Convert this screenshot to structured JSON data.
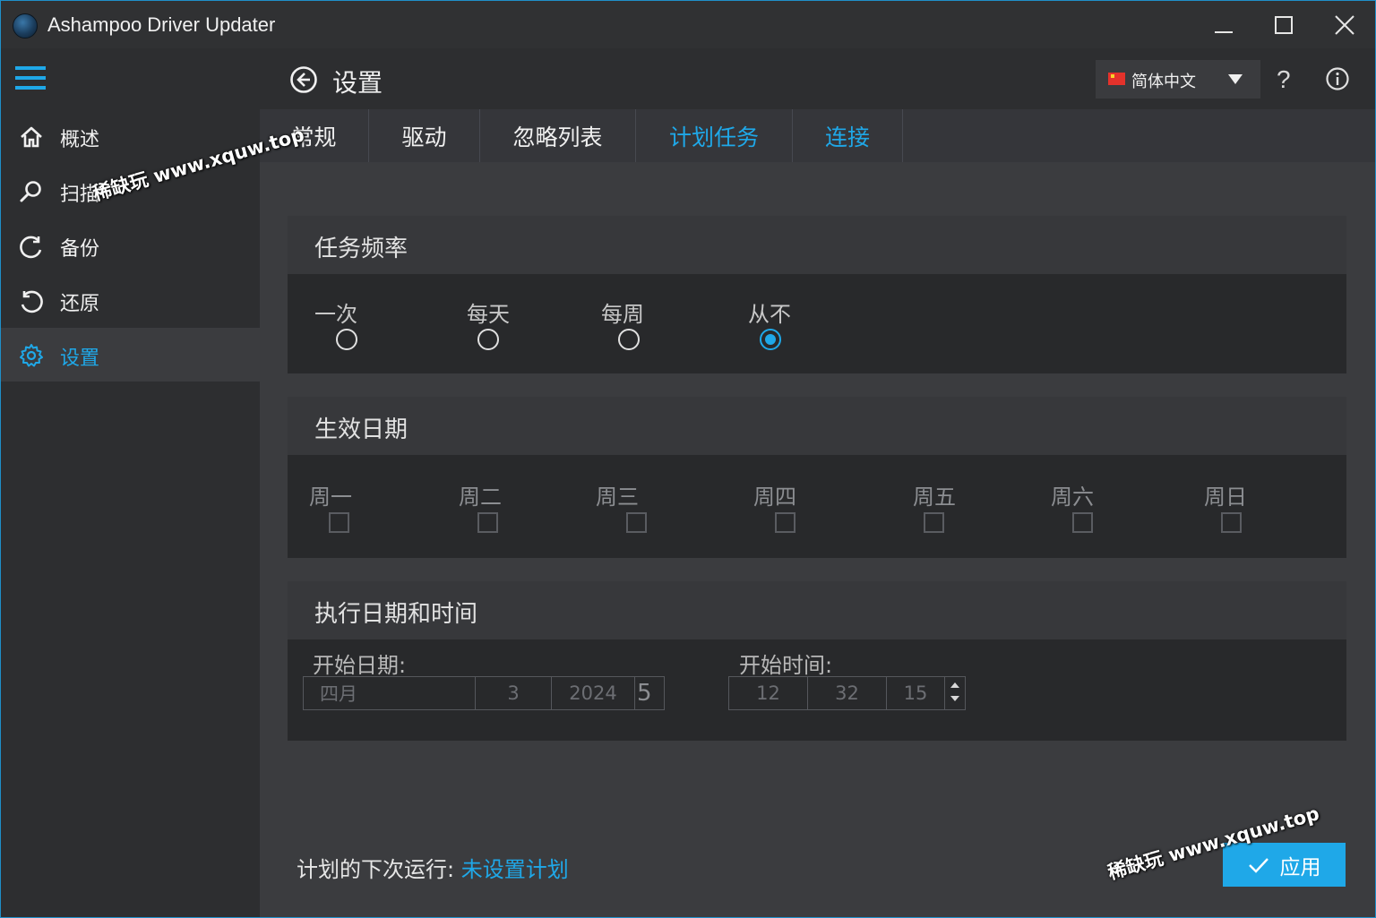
{
  "window": {
    "title": "Ashampoo Driver Updater"
  },
  "sidebar": {
    "items": [
      {
        "label": "概述",
        "icon": "home-icon"
      },
      {
        "label": "扫描",
        "icon": "search-icon"
      },
      {
        "label": "备份",
        "icon": "backup-icon"
      },
      {
        "label": "还原",
        "icon": "restore-icon"
      },
      {
        "label": "设置",
        "icon": "gear-icon",
        "active": true
      }
    ]
  },
  "header": {
    "title": "设置",
    "language": "简体中文",
    "help": "?"
  },
  "tabs": [
    {
      "label": "常规"
    },
    {
      "label": "驱动"
    },
    {
      "label": "忽略列表"
    },
    {
      "label": "计划任务",
      "active": true
    },
    {
      "label": "连接"
    }
  ],
  "frequency": {
    "title": "任务频率",
    "options": [
      "一次",
      "每天",
      "每周",
      "从不"
    ],
    "selected": "从不"
  },
  "weekdays": {
    "title": "生效日期",
    "days": [
      "周一",
      "周二",
      "周三",
      "周四",
      "周五",
      "周六",
      "周日"
    ]
  },
  "schedule": {
    "title": "执行日期和时间",
    "start_date_label": "开始日期:",
    "month": "四月",
    "day": "3",
    "year": "2024",
    "date_suffix": "5",
    "start_time_label": "开始时间:",
    "hour": "12",
    "minute": "32",
    "second": "15"
  },
  "footer": {
    "next_run_label": "计划的下次运行: ",
    "next_run_value": "未设置计划",
    "apply_label": "应用"
  },
  "watermark": "稀缺玩 www.xquw.top",
  "colors": {
    "accent": "#1fa8e8",
    "background": "#2d2e30",
    "panel": "#28292b"
  }
}
